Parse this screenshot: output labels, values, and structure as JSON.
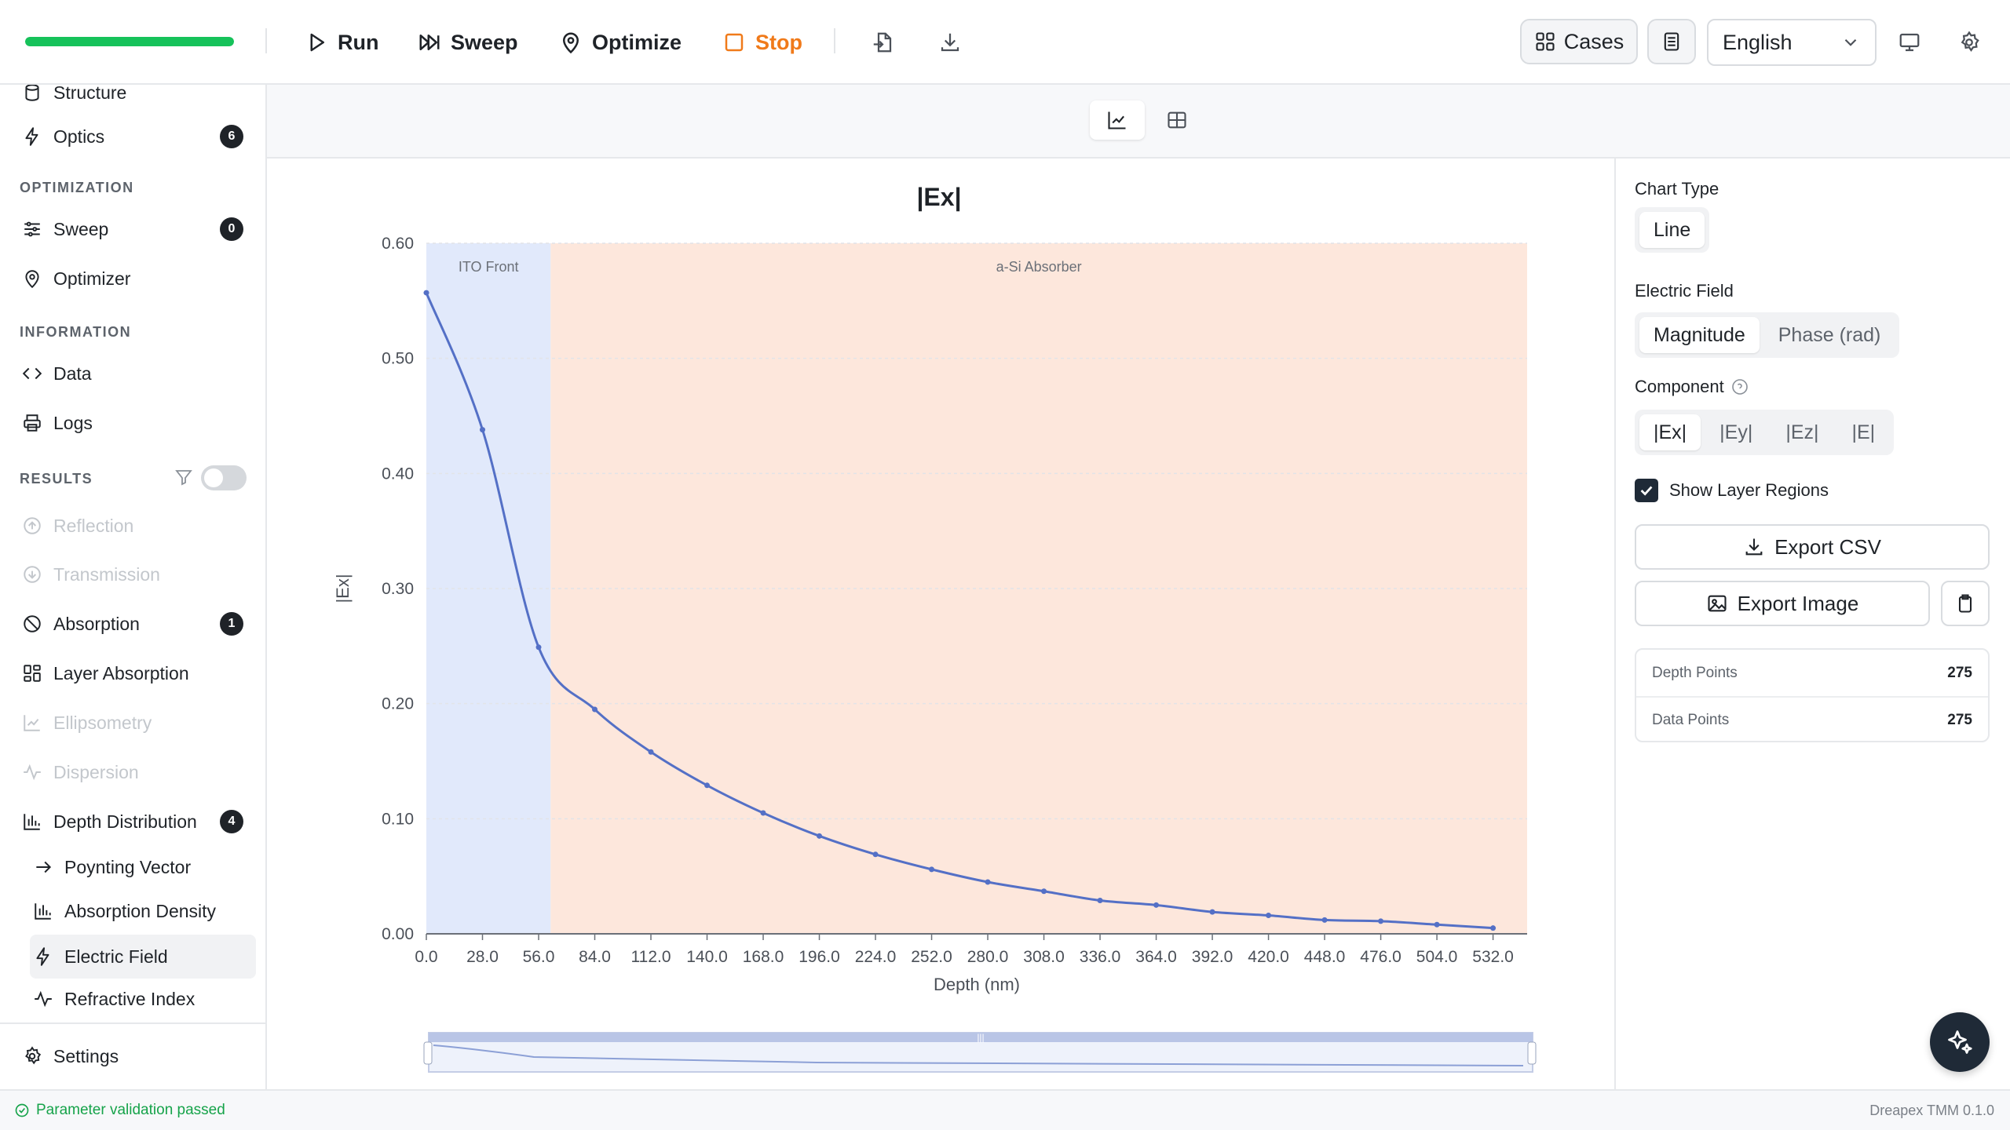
{
  "toolbar": {
    "progress_fraction": 1.0,
    "run": "Run",
    "sweep": "Sweep",
    "optimize": "Optimize",
    "stop": "Stop",
    "cases": "Cases",
    "language": "English"
  },
  "sidebar": {
    "items_top": [
      {
        "label": "Structure"
      },
      {
        "label": "Optics",
        "badge": "6"
      }
    ],
    "optimization_heading": "OPTIMIZATION",
    "optimization_items": [
      {
        "label": "Sweep",
        "badge": "0"
      },
      {
        "label": "Optimizer"
      }
    ],
    "information_heading": "INFORMATION",
    "information_items": [
      {
        "label": "Data"
      },
      {
        "label": "Logs"
      }
    ],
    "results_heading": "RESULTS",
    "results_items": [
      {
        "label": "Reflection",
        "disabled": true
      },
      {
        "label": "Transmission",
        "disabled": true
      },
      {
        "label": "Absorption",
        "badge": "1"
      },
      {
        "label": "Layer Absorption"
      },
      {
        "label": "Ellipsometry",
        "disabled": true
      },
      {
        "label": "Dispersion",
        "disabled": true
      },
      {
        "label": "Depth Distribution",
        "badge": "4"
      }
    ],
    "depth_sub_items": [
      {
        "label": "Poynting Vector"
      },
      {
        "label": "Absorption Density"
      },
      {
        "label": "Electric Field",
        "active": true
      },
      {
        "label": "Refractive Index"
      }
    ],
    "settings": "Settings"
  },
  "right_panel": {
    "chart_type_label": "Chart Type",
    "chart_type_value": "Line",
    "electric_field_label": "Electric Field",
    "electric_field_options": [
      "Magnitude",
      "Phase (rad)"
    ],
    "electric_field_selected": "Magnitude",
    "component_label": "Component",
    "component_options": [
      "|Ex|",
      "|Ey|",
      "|Ez|",
      "|E|"
    ],
    "component_selected": "|Ex|",
    "show_layer_regions": "Show Layer Regions",
    "export_csv": "Export CSV",
    "export_image": "Export Image",
    "depth_points_label": "Depth Points",
    "depth_points_value": "275",
    "data_points_label": "Data Points",
    "data_points_value": "275"
  },
  "status": {
    "message": "Parameter validation passed",
    "version": "Dreapex TMM 0.1.0"
  },
  "colors": {
    "progress": "#16c25a",
    "line": "#5470c6",
    "region_ito": "#e1e9fb",
    "region_asi": "#fde7dc",
    "stop": "#f07a1a",
    "status_ok": "#16a34a"
  },
  "chart_data": {
    "type": "line",
    "title": "|Ex|",
    "xlabel": "Depth (nm)",
    "ylabel": "|Ex|",
    "xlim": [
      0,
      549
    ],
    "ylim": [
      0,
      0.6
    ],
    "x_tick_labels": [
      "0.0",
      "28.0",
      "56.0",
      "84.0",
      "112.0",
      "140.0",
      "168.0",
      "196.0",
      "224.0",
      "252.0",
      "280.0",
      "308.0",
      "336.0",
      "364.0",
      "392.0",
      "420.0",
      "448.0",
      "476.0",
      "504.0",
      "532.0"
    ],
    "y_tick_labels": [
      "0.00",
      "0.10",
      "0.20",
      "0.30",
      "0.40",
      "0.50",
      "0.60"
    ],
    "grid": true,
    "regions": [
      {
        "label": "ITO Front",
        "start": 0,
        "end": 62
      },
      {
        "label": "a-Si Absorber",
        "start": 62,
        "end": 549
      }
    ],
    "series": [
      {
        "x": [
          0,
          28,
          56,
          84,
          112,
          140,
          168,
          196,
          224,
          252,
          280,
          308,
          336,
          364,
          392,
          420,
          448,
          476,
          504,
          532
        ],
        "y": [
          0.557,
          0.438,
          0.249,
          0.195,
          0.158,
          0.129,
          0.105,
          0.085,
          0.069,
          0.056,
          0.045,
          0.037,
          0.029,
          0.025,
          0.019,
          0.016,
          0.012,
          0.011,
          0.008,
          0.005
        ]
      }
    ]
  }
}
